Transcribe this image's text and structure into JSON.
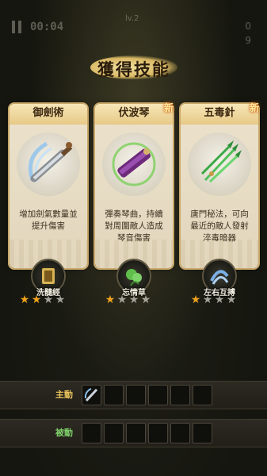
{
  "hud": {
    "timer": "00:04",
    "level": "lv.2",
    "sub_text": "",
    "kills": "0",
    "coins": "9"
  },
  "banner": {
    "title": "獲得技能"
  },
  "cards": [
    {
      "name": "御劍術",
      "stars": 2,
      "desc_lines": [
        "增加劍氣數量並",
        "提升傷害"
      ],
      "is_new": false,
      "new_label": ""
    },
    {
      "name": "伏波琴",
      "stars": 1,
      "desc_lines": [
        "彈奏琴曲，持續",
        "對周圍敵人造成",
        "琴音傷害"
      ],
      "is_new": true,
      "new_label": "新"
    },
    {
      "name": "五毒針",
      "stars": 1,
      "desc_lines": [
        "唐門秘法，可向",
        "最近的敵人發射",
        "淬毒暗器"
      ],
      "is_new": true,
      "new_label": "新"
    }
  ],
  "relics": [
    {
      "label": "洗髓經"
    },
    {
      "label": "忘情草"
    },
    {
      "label": "左右互搏"
    }
  ],
  "loadout": {
    "active_label": "主動",
    "passive_label": "被動",
    "slot_count": 6
  },
  "colors": {
    "star_on": "#f0a31c",
    "star_off": "#a6a39a",
    "card_border": "#c9a86a",
    "new_glow": "#d86a10"
  }
}
